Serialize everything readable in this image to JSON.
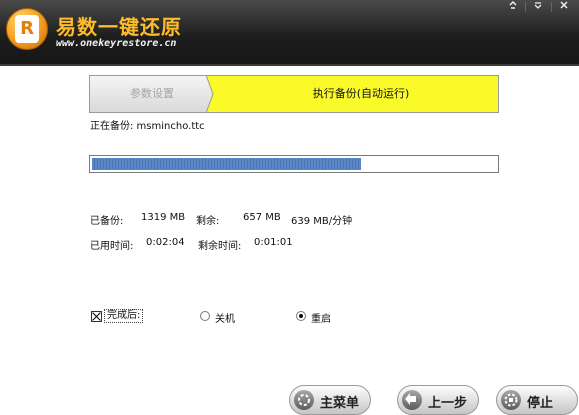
{
  "header": {
    "app_name": "易数一键还原",
    "website": "www.onekeyrestore.cn",
    "logo_glyph": "R",
    "icons": [
      "restore-down-icon",
      "dropdown-icon",
      "close-icon"
    ]
  },
  "steps": [
    {
      "label": "参数设置",
      "active": false
    },
    {
      "label": "执行备份(自动运行)",
      "active": true
    }
  ],
  "current_file": "正在备份: msmincho.ttc",
  "progress": {
    "percent": 66.5
  },
  "stats": {
    "backed_up_label": "已备份:",
    "backed_up_value": "1319 MB",
    "remaining_label": "剩余:",
    "remaining_value": "657 MB",
    "speed": "639 MB/分钟",
    "elapsed_label": "已用时间:",
    "elapsed_value": "0:02:04",
    "remaining_time_label": "剩余时间:",
    "remaining_time_value": "0:01:01"
  },
  "after_completion": {
    "label": "完成后:",
    "checked": true,
    "options": [
      {
        "label": "关机",
        "selected": false
      },
      {
        "label": "重启",
        "selected": true
      }
    ]
  },
  "buttons": {
    "main_menu": "主菜单",
    "previous": "上一步",
    "stop": "停止"
  },
  "colors": {
    "header_bg": "#1e1e1e",
    "title": "#ffbc28",
    "active_step": "#fafa2a",
    "progress_fill": "#5b87c7"
  }
}
